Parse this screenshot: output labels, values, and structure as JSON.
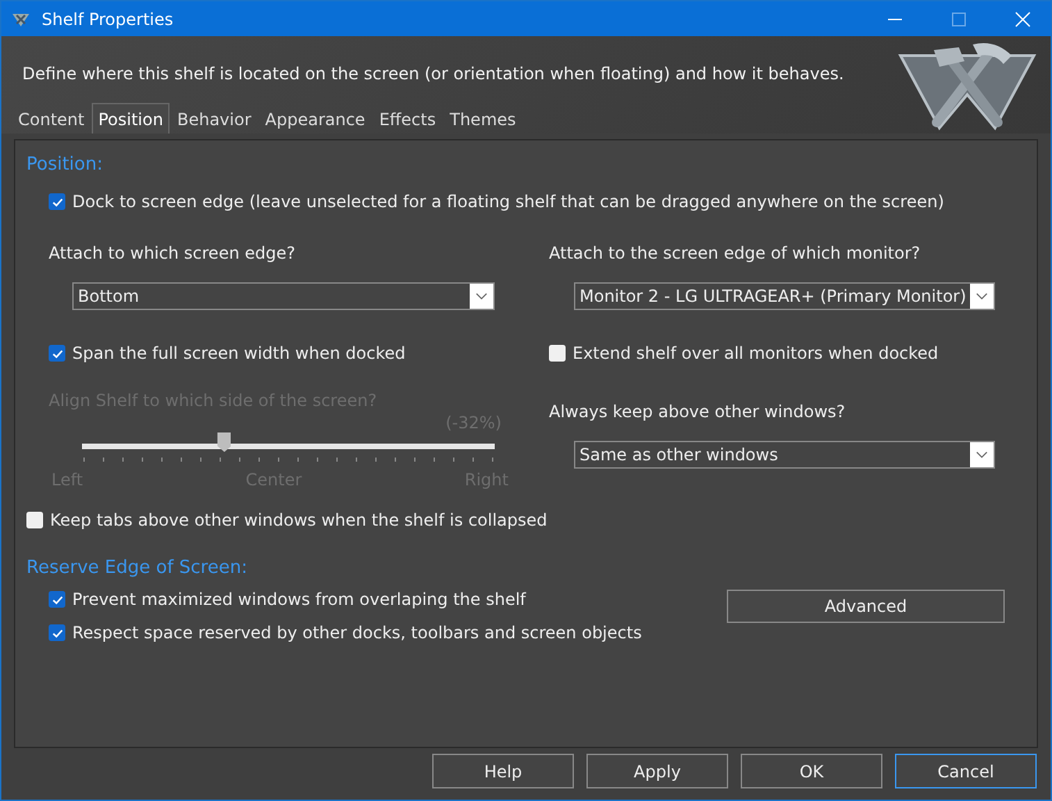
{
  "window": {
    "title": "Shelf Properties"
  },
  "header": {
    "description": "Define where this shelf is located on the screen (or orientation when floating) and how it behaves."
  },
  "tabs": [
    {
      "label": "Content",
      "selected": false
    },
    {
      "label": "Position",
      "selected": true
    },
    {
      "label": "Behavior",
      "selected": false
    },
    {
      "label": "Appearance",
      "selected": false
    },
    {
      "label": "Effects",
      "selected": false
    },
    {
      "label": "Themes",
      "selected": false
    }
  ],
  "position": {
    "heading": "Position:",
    "dock": {
      "label": "Dock to screen edge (leave unselected for a floating shelf that can be dragged anywhere on the screen)",
      "checked": true
    },
    "edge": {
      "label": "Attach to which screen edge?",
      "value": "Bottom"
    },
    "monitor": {
      "label": "Attach to the screen edge of which monitor?",
      "value": "Monitor 2 - LG ULTRAGEAR+ (Primary Monitor)"
    },
    "span": {
      "label": "Span the full screen width when docked",
      "checked": true
    },
    "extend": {
      "label": "Extend shelf over all monitors when docked",
      "checked": false
    },
    "align": {
      "label": "Align Shelf to which side of the screen?",
      "reading": "(-32%)",
      "level": 0.345,
      "disabled": true,
      "marks": [
        "Left",
        "Center",
        "Right"
      ]
    },
    "above": {
      "label": "Always keep above other windows?",
      "value": "Same as other windows"
    },
    "keep_tabs": {
      "label": "Keep tabs above other windows when the shelf is collapsed",
      "checked": false
    }
  },
  "reserve": {
    "heading": "Reserve Edge of Screen:",
    "options": [
      {
        "label": "Prevent maximized windows from overlaping the shelf",
        "checked": true
      },
      {
        "label": "Respect space reserved by other docks, toolbars and screen objects",
        "checked": true
      }
    ],
    "advanced": "Advanced"
  },
  "buttons": [
    {
      "label": "Help",
      "selected": false
    },
    {
      "label": "Apply",
      "selected": false
    },
    {
      "label": "OK",
      "selected": false
    },
    {
      "label": "Cancel",
      "selected": true
    }
  ]
}
